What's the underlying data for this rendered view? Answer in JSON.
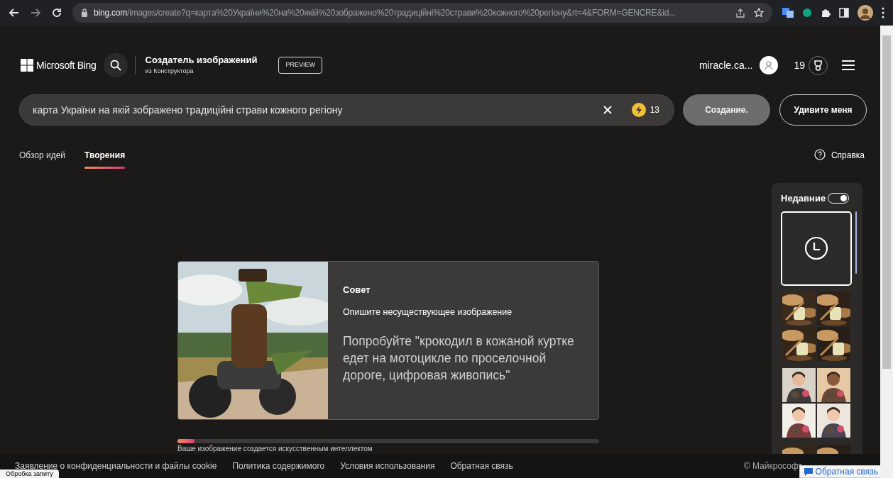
{
  "browser": {
    "url_host": "bing.com",
    "url_path": "/images/create?q=карта%20України%20на%20якій%20зображено%20традиційні%20страви%20кожного%20регіону&rt=4&FORM=GENCRE&id..."
  },
  "header": {
    "brand": "Microsoft Bing",
    "title": "Создатель изображений",
    "subtitle": "из Конструктора",
    "badge": "PREVIEW",
    "user": "miracle.ca...",
    "points": "19"
  },
  "search": {
    "value": "карта України на якій зображено традиційні страви кожного регіону",
    "boosts": "13",
    "create_button": "Создание.",
    "surprise_button": "Удивите меня"
  },
  "tabs": [
    {
      "label": "Обзор идей",
      "selected": false
    },
    {
      "label": "Творения",
      "selected": true
    }
  ],
  "help": "Справка",
  "tip": {
    "image": {
      "kind": "picture"
    },
    "heading": "Совет",
    "subtitle": "Опишите несуществующее изображение",
    "body": "Попробуйте \"крокодил в кожаной куртке едет на мотоцикле по проселочной дороге, цифровая живопись\""
  },
  "progress": {
    "level": 0.04,
    "caption": "Ваше изображение создается искусственным интеллектом"
  },
  "recent": {
    "title": "Недавние",
    "on": true,
    "items": [
      {
        "kind": "pending"
      },
      {
        "kind": "picture"
      },
      {
        "kind": "picture"
      },
      {
        "kind": "picture"
      }
    ]
  },
  "footer": {
    "links": [
      "Заявление о конфиденциальности и файлы cookie",
      "Политика содержимого",
      "Условия использования",
      "Обратная связь"
    ],
    "copyright": "© Майкрософт",
    "feedback_button": "Обратная связь"
  },
  "status_bubble": "Обробка запиту"
}
